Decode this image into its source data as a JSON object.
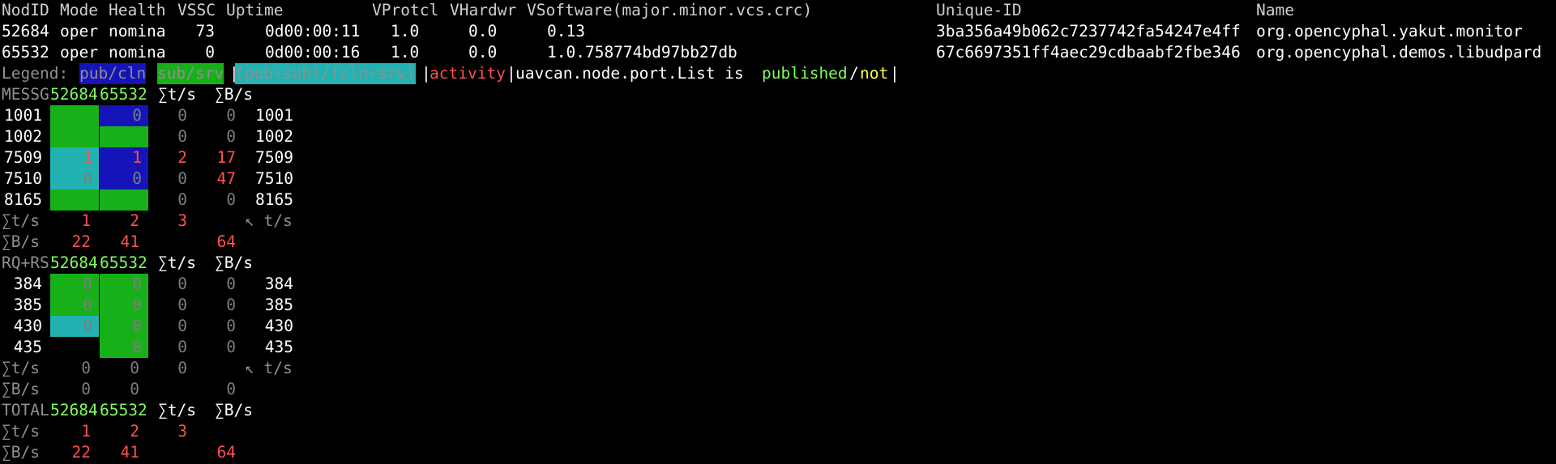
{
  "nodes": {
    "headers": [
      "NodID",
      "Mode",
      "Health",
      "VSSC",
      "Uptime",
      "VProtcl",
      "VHardwr",
      "VSoftware(major.minor.vcs.crc)",
      "Unique-ID",
      "Name"
    ],
    "rows": [
      [
        "52684",
        "oper",
        "nomina",
        "73",
        "0d00:00:11",
        "1.0",
        "0.0",
        "0.13",
        "3ba356a49b062c7237742fa54247e4ff",
        "org.opencyphal.yakut.monitor"
      ],
      [
        "65532",
        "oper",
        "nomina",
        "0",
        "0d00:00:16",
        "1.0",
        "0.0",
        "1.0.758774bd97bb27db",
        "67c6697351ff4aec29cdbaabf2fbe346",
        "org.opencyphal.demos.libudpard"
      ]
    ]
  },
  "legend": {
    "label": "Legend:",
    "pub_cln": "pub/cln",
    "sub_srv": "sub/srv",
    "both": "(pub+sub)/(cln+srv)",
    "activity": "activity",
    "port_list": "uavcan.node.port.List is",
    "published": "published",
    "slash": "/",
    "not": "not",
    "separator": "|",
    "colors": {
      "pub_cln": "#1414b8",
      "sub_srv": "#18b018",
      "both": "#22b2b2",
      "activity": "#ff5050",
      "published": "#7dff5a",
      "not": "#ffff40"
    }
  },
  "messages": {
    "title": "MESSG",
    "node_headers": [
      "52684",
      "65532"
    ],
    "col_ts": "∑t/s",
    "col_bs": "∑B/s",
    "rows": [
      {
        "port": "1001",
        "cells": [
          {
            "bg": "sub",
            "v": ""
          },
          {
            "bg": "pub",
            "v": "0"
          }
        ],
        "ts": "0",
        "bs": "0",
        "port_r": "1001"
      },
      {
        "port": "1002",
        "cells": [
          {
            "bg": "sub",
            "v": ""
          },
          {
            "bg": "sub",
            "v": ""
          }
        ],
        "ts": "0",
        "bs": "0",
        "port_r": "1002"
      },
      {
        "port": "7509",
        "cells": [
          {
            "bg": "both",
            "v": "1"
          },
          {
            "bg": "pub",
            "v": "1"
          }
        ],
        "ts": "2",
        "bs": "17",
        "port_r": "7509"
      },
      {
        "port": "7510",
        "cells": [
          {
            "bg": "both",
            "v": "0"
          },
          {
            "bg": "pub",
            "v": "0"
          }
        ],
        "ts": "0",
        "bs": "47",
        "port_r": "7510"
      },
      {
        "port": "8165",
        "cells": [
          {
            "bg": "sub",
            "v": ""
          },
          {
            "bg": "sub",
            "v": ""
          }
        ],
        "ts": "0",
        "bs": "0",
        "port_r": "8165"
      }
    ],
    "sum_ts": {
      "label": "∑t/s",
      "values": [
        "1",
        "2"
      ],
      "total": "3",
      "note": "↖ t/s"
    },
    "sum_bs": {
      "label": "∑B/s",
      "values": [
        "22",
        "41"
      ],
      "total": "64"
    }
  },
  "services": {
    "title": "RQ+RS",
    "node_headers": [
      "52684",
      "65532"
    ],
    "col_ts": "∑t/s",
    "col_bs": "∑B/s",
    "rows": [
      {
        "port": "384",
        "cells": [
          {
            "bg": "sub",
            "v": "0"
          },
          {
            "bg": "sub",
            "v": "0"
          }
        ],
        "ts": "0",
        "bs": "0",
        "port_r": "384"
      },
      {
        "port": "385",
        "cells": [
          {
            "bg": "sub",
            "v": "0"
          },
          {
            "bg": "sub",
            "v": "0"
          }
        ],
        "ts": "0",
        "bs": "0",
        "port_r": "385"
      },
      {
        "port": "430",
        "cells": [
          {
            "bg": "both",
            "v": "0"
          },
          {
            "bg": "sub",
            "v": "0"
          }
        ],
        "ts": "0",
        "bs": "0",
        "port_r": "430"
      },
      {
        "port": "435",
        "cells": [
          {
            "bg": "none",
            "v": ""
          },
          {
            "bg": "sub",
            "v": "0"
          }
        ],
        "ts": "0",
        "bs": "0",
        "port_r": "435"
      }
    ],
    "sum_ts": {
      "label": "∑t/s",
      "values": [
        "0",
        "0"
      ],
      "total": "0",
      "note": "↖ t/s"
    },
    "sum_bs": {
      "label": "∑B/s",
      "values": [
        "0",
        "0"
      ],
      "total": "0"
    }
  },
  "total": {
    "title": "TOTAL",
    "node_headers": [
      "52684",
      "65532"
    ],
    "col_ts": "∑t/s",
    "col_bs": "∑B/s",
    "sum_ts": {
      "label": "∑t/s",
      "values": [
        "1",
        "2"
      ],
      "total": "3"
    },
    "sum_bs": {
      "label": "∑B/s",
      "values": [
        "22",
        "41"
      ],
      "total": "64"
    }
  }
}
